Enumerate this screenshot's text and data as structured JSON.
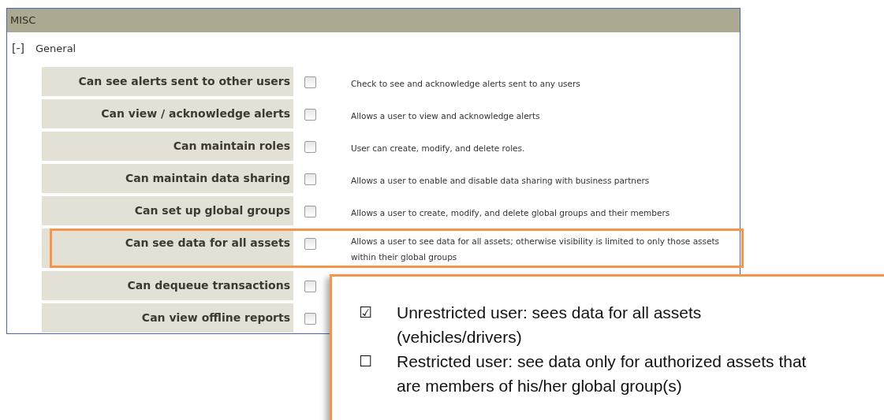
{
  "panel": {
    "title": "MISC",
    "section": {
      "toggle": "[-]",
      "label": "General",
      "permissions": [
        {
          "label": "Can see alerts sent to other users",
          "checked": false,
          "description": "Check to see and acknowledge alerts sent to any users",
          "highlighted": false
        },
        {
          "label": "Can view / acknowledge alerts",
          "checked": false,
          "description": "Allows a user to view and acknowledge alerts",
          "highlighted": false
        },
        {
          "label": "Can maintain roles",
          "checked": false,
          "description": "User can create, modify, and delete roles.",
          "highlighted": false
        },
        {
          "label": "Can maintain data sharing",
          "checked": false,
          "description": "Allows a user to enable and disable data sharing with business partners",
          "highlighted": false
        },
        {
          "label": "Can set up global groups",
          "checked": false,
          "description": "Allows a user to create, modify, and delete global groups and their members",
          "highlighted": false
        },
        {
          "label": "Can see data for all assets",
          "checked": false,
          "description": "Allows a user to see data for all assets; otherwise visibility is limited to only those assets within their global groups",
          "highlighted": true
        },
        {
          "label": "Can dequeue transactions",
          "checked": false,
          "highlighted": false
        },
        {
          "label": "Can view offline reports",
          "checked": false,
          "highlighted": false
        }
      ]
    }
  },
  "callout": {
    "items": [
      {
        "marker": "☑",
        "text": "Unrestricted user: sees data for all assets (vehicles/drivers)"
      },
      {
        "marker": "☐",
        "text": "Restricted user: see data only for authorized assets that are members of his/her global group(s)"
      }
    ]
  }
}
